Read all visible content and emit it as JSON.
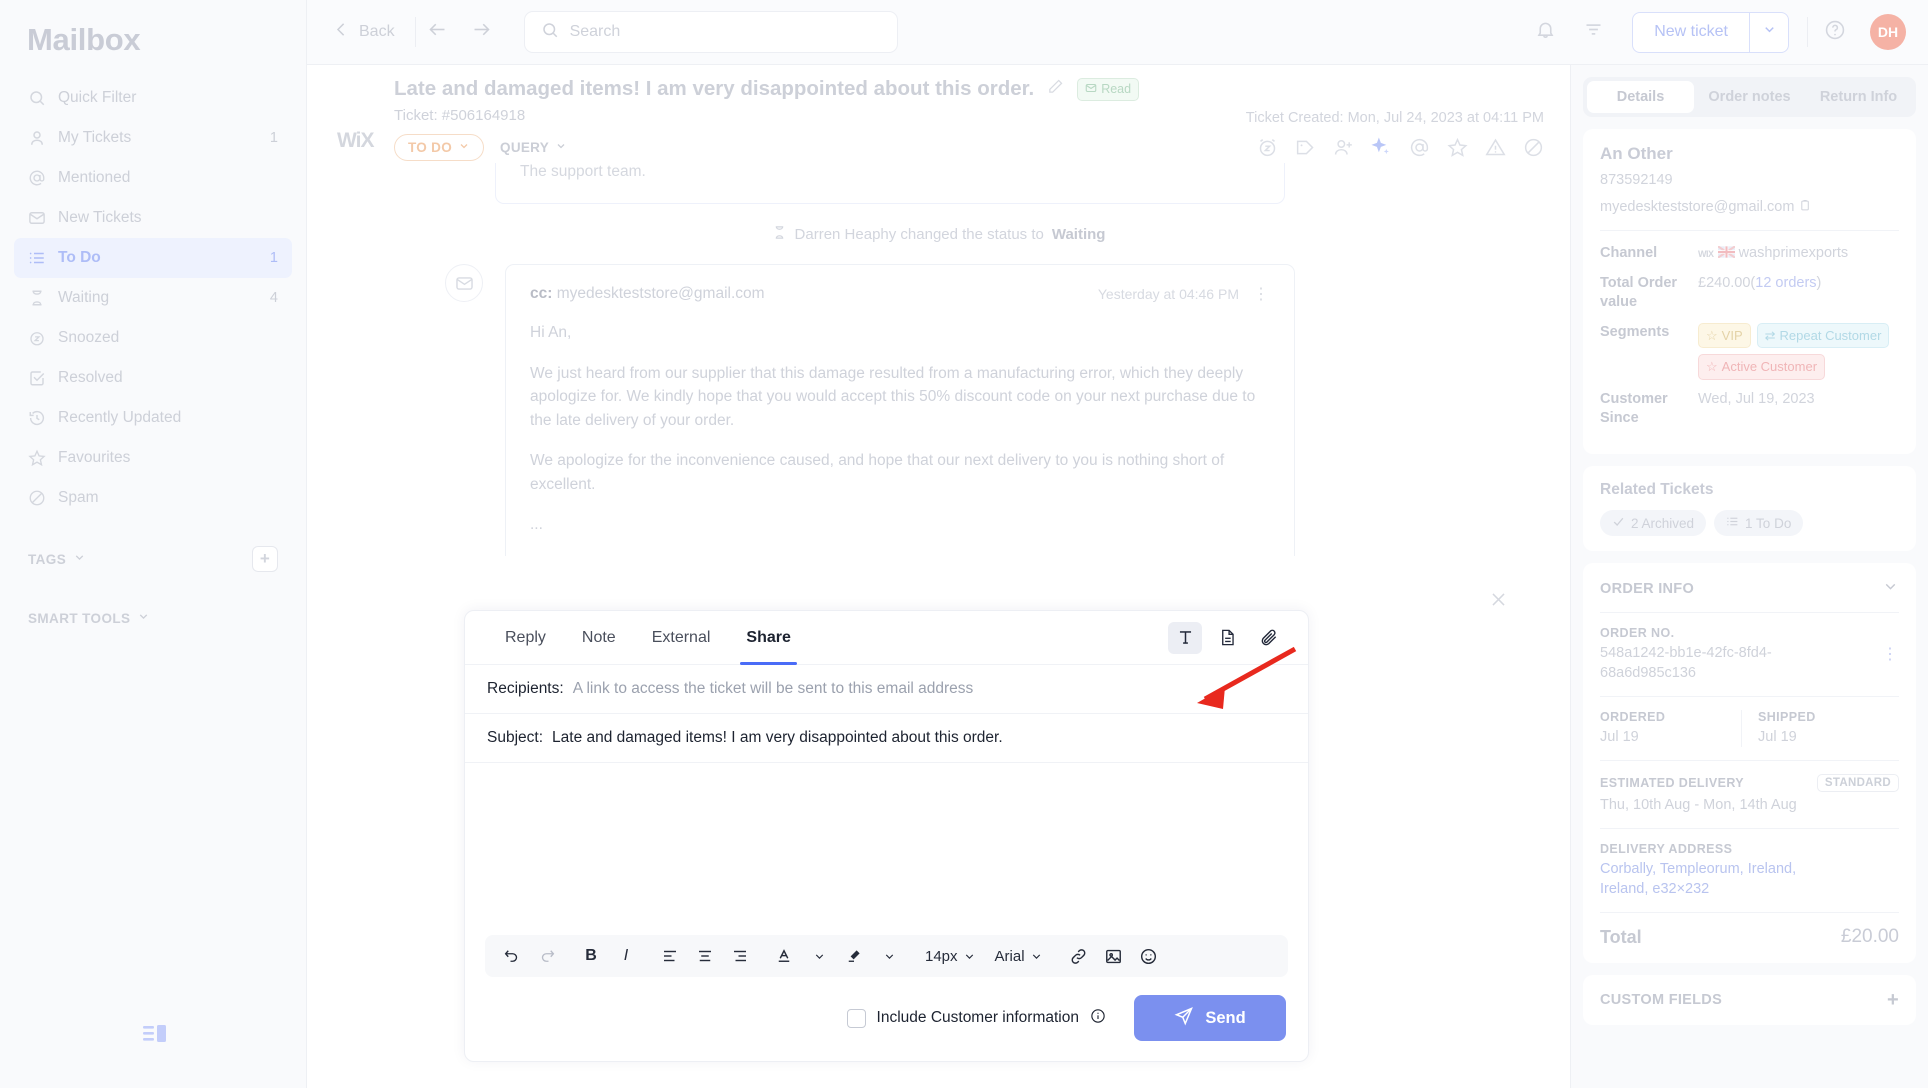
{
  "sidebar": {
    "brand": "Mailbox",
    "items": [
      {
        "icon": "search-icon",
        "label": "Quick Filter",
        "count": "",
        "active": false
      },
      {
        "icon": "person-icon",
        "label": "My Tickets",
        "count": "1",
        "active": false
      },
      {
        "icon": "at-icon",
        "label": "Mentioned",
        "count": "",
        "active": false
      },
      {
        "icon": "envelope-icon",
        "label": "New Tickets",
        "count": "",
        "active": false
      },
      {
        "icon": "list-icon",
        "label": "To Do",
        "count": "1",
        "active": true
      },
      {
        "icon": "hourglass-icon",
        "label": "Waiting",
        "count": "4",
        "active": false
      },
      {
        "icon": "snooze-icon",
        "label": "Snoozed",
        "count": "",
        "active": false
      },
      {
        "icon": "check-box-icon",
        "label": "Resolved",
        "count": "",
        "active": false
      },
      {
        "icon": "history-icon",
        "label": "Recently Updated",
        "count": "",
        "active": false
      },
      {
        "icon": "star-icon",
        "label": "Favourites",
        "count": "",
        "active": false
      },
      {
        "icon": "ban-icon",
        "label": "Spam",
        "count": "",
        "active": false
      }
    ],
    "tags_label": "TAGS",
    "add_tag_label": "+",
    "smart_tools_label": "SMART TOOLS"
  },
  "topbar": {
    "back_label": "Back",
    "search_placeholder": "Search",
    "search_value": "",
    "new_ticket_label": "New ticket",
    "avatar_initials": "DH"
  },
  "ticket": {
    "title": "Late and damaged items! I am very disappointed about this order.",
    "read_badge": "Read",
    "source_logo": "WiX",
    "ticket_no": "Ticket: #506164918",
    "status_chip": "TO DO",
    "type_chip": "QUERY",
    "created": "Ticket Created: Mon, Jul 24, 2023 at 04:11 PM"
  },
  "thread": {
    "previous_tail": "The support team.",
    "status_event": "Darren Heaphy changed the status to ",
    "status_event_value": "Waiting",
    "message": {
      "cc_label": "cc:",
      "cc_value": "myedeskteststore@gmail.com",
      "time": "Yesterday at 04:46 PM",
      "greeting": "Hi An,",
      "paragraph1": "We just heard from our supplier that this damage resulted from a manufacturing error, which they deeply apologize for. We kindly hope that you would accept this 50% discount code on your next purchase due to the late delivery of your order.",
      "paragraph2": "We apologize for the inconvenience caused, and hope that our next delivery to you is nothing short of excellent.",
      "ellipsis": "..."
    }
  },
  "editor": {
    "tabs": [
      {
        "label": "Reply",
        "active": false
      },
      {
        "label": "Note",
        "active": false
      },
      {
        "label": "External",
        "active": false
      },
      {
        "label": "Share",
        "active": true
      }
    ],
    "recipients_label": "Recipients:",
    "recipients_placeholder": "A link to access the ticket will be sent to this email address",
    "recipients_value": "",
    "subject_label": "Subject:",
    "subject_value": "Late and damaged items! I am very disappointed about this order.",
    "body_value": "",
    "font_size": "14px",
    "font_family": "Arial",
    "include_customer_info_label": "Include Customer information",
    "include_customer_info_checked": false,
    "send_label": "Send"
  },
  "details": {
    "tabs": [
      {
        "label": "Details",
        "active": true
      },
      {
        "label": "Order notes",
        "active": false
      },
      {
        "label": "Return Info",
        "active": false
      }
    ],
    "customer": {
      "name": "An Other",
      "id": "873592149",
      "email": "myedeskteststore@gmail.com"
    },
    "fields": [
      {
        "key": "Channel",
        "value": "washprimexports"
      },
      {
        "key": "Total Order value",
        "value": "£240.00",
        "link": "12 orders"
      },
      {
        "key": "Customer Since",
        "value": "Wed, Jul 19, 2023"
      }
    ],
    "segments_label": "Segments",
    "segments": [
      {
        "label": "VIP",
        "style": "vip"
      },
      {
        "label": "Repeat Customer",
        "style": "repeat"
      },
      {
        "label": "Active Customer",
        "style": "active-c"
      }
    ],
    "related": {
      "title": "Related Tickets",
      "pills": [
        {
          "label": "2 Archived",
          "icon": "check-icon"
        },
        {
          "label": "1 To Do",
          "icon": "list-icon"
        }
      ]
    },
    "order_info": {
      "section_title": "ORDER INFO",
      "order_no_label": "ORDER NO.",
      "order_no_value": "548a1242-bb1e-42fc-8fd4-68a6d985c136",
      "ordered_label": "ORDERED",
      "ordered_value": "Jul 19",
      "shipped_label": "SHIPPED",
      "shipped_value": "Jul 19",
      "estimated_label": "ESTIMATED DELIVERY",
      "estimated_badge": "STANDARD",
      "estimated_value": "Thu, 10th Aug - Mon, 14th Aug",
      "address_label": "DELIVERY ADDRESS",
      "address_value": "Corbally, Templeorum, Ireland, Ireland, e32×232",
      "total_label": "Total",
      "total_value": "£20.00"
    },
    "custom_fields": {
      "section_title": "CUSTOM FIELDS",
      "add_label": "+"
    }
  },
  "colors": {
    "accent": "#4a6cf7",
    "send_button": "#7b90ef",
    "annotation_arrow": "#e8291e",
    "avatar": "#f5b2a5"
  }
}
